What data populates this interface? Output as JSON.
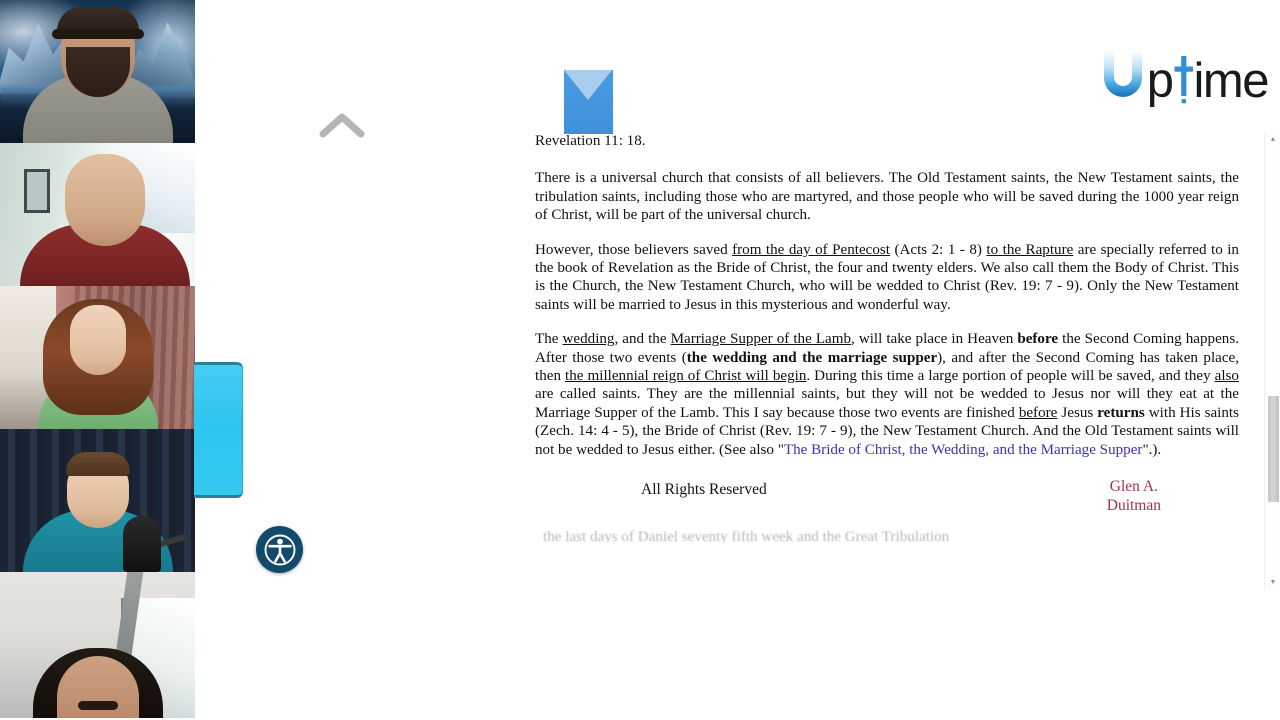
{
  "app": {
    "brand_name": "Uptime",
    "brand_u": "U",
    "brand_p": "p",
    "brand_rest": "ime",
    "accent_blue": "#3f90da",
    "cyan_tab": "#2dc5ef",
    "logo_dark": "#1a1a1a",
    "byline_color": "#a6324a",
    "link_color": "#3a32b8"
  },
  "controls": {
    "chevron_up_name": "collapse-toolbar",
    "accessibility_label": "Accessibility options",
    "side_tab_label": "Expand participant panel",
    "mail_badge_label": "Unread message"
  },
  "video_rail": {
    "tiles": [
      {
        "name": "participant-tile-1",
        "description": "Man with beard and dark cap, snowy mountain virtual background"
      },
      {
        "name": "participant-tile-2",
        "description": "Older man with hand on chin, red shirt, bright window behind"
      },
      {
        "name": "participant-tile-3",
        "description": "Woman with long auburn hair in green top, patterned curtain"
      },
      {
        "name": "participant-tile-4",
        "description": "Man in teal shirt speaking into a large microphone"
      },
      {
        "name": "participant-tile-5",
        "description": "Man with moustache seated inside a vehicle"
      }
    ]
  },
  "document": {
    "verse_reference": "Revelation 11: 18.",
    "paragraphs": [
      {
        "id": "p-universal-church",
        "runs": [
          {
            "t": "There is a universal church that consists of all believers. The Old Testament saints, the New Testament saints, the tribulation saints, including those who are martyred, and those people who will be saved during the 1000 year reign of Christ, will be part of the universal church.",
            "style": "plain"
          }
        ]
      },
      {
        "id": "p-bride-of-christ",
        "runs": [
          {
            "t": "However, those believers saved ",
            "style": "plain"
          },
          {
            "t": "from the day of Pentecost",
            "style": "underline"
          },
          {
            "t": " (Acts 2: 1 - 8) ",
            "style": "plain"
          },
          {
            "t": "to the Rapture",
            "style": "underline"
          },
          {
            "t": " are specially referred to in the book of Revelation as the Bride of Christ, the four and twenty elders. We also call them the Body of Christ. This is the Church, the New Testament Church, who will be wedded to Christ (Rev. 19: 7 - 9). Only the New Testament saints will be married to Jesus in this mysterious and wonderful way.",
            "style": "plain"
          }
        ]
      },
      {
        "id": "p-wedding-supper",
        "runs": [
          {
            "t": "The ",
            "style": "plain"
          },
          {
            "t": "wedding",
            "style": "underline"
          },
          {
            "t": ", and the ",
            "style": "plain"
          },
          {
            "t": "Marriage Supper of the Lamb",
            "style": "underline"
          },
          {
            "t": ", will take place in Heaven ",
            "style": "plain"
          },
          {
            "t": "before",
            "style": "bold"
          },
          {
            "t": " the Second Coming happens. After those two events (",
            "style": "plain"
          },
          {
            "t": "the wedding and the marriage supper",
            "style": "bold"
          },
          {
            "t": "), and after the Second Coming has taken place, then ",
            "style": "plain"
          },
          {
            "t": "the millennial reign of Christ will begin",
            "style": "underline"
          },
          {
            "t": ". During this time a large portion of people will be saved, and they ",
            "style": "plain"
          },
          {
            "t": "also",
            "style": "underline"
          },
          {
            "t": " are called saints. They are the millennial saints, but they will not be wedded to Jesus nor will they eat at the Marriage Supper of the Lamb. This I say because those two events are finished ",
            "style": "plain"
          },
          {
            "t": "before",
            "style": "underline"
          },
          {
            "t": " Jesus ",
            "style": "plain"
          },
          {
            "t": "returns",
            "style": "bold"
          },
          {
            "t": " with His saints (Zech. 14: 4 - 5), the Bride of Christ (Rev. 19: 7 - 9), the New Testament Church. And the Old Testament saints will not be wedded to Jesus either. (See also \"",
            "style": "plain"
          },
          {
            "t": "The Bride of Christ, the Wedding, and the Marriage Supper",
            "style": "link"
          },
          {
            "t": "\".).",
            "style": "plain"
          }
        ]
      }
    ],
    "footer": {
      "rights": "All Rights Reserved",
      "author_line1": "Glen A.",
      "author_line2": "Duitman"
    },
    "clipped_next_line": "the last days of Daniel seventy fifth week and the Great Tribulation"
  },
  "scrollbar": {
    "up_arrow_glyph": "▲",
    "down_arrow_glyph": "▼"
  }
}
